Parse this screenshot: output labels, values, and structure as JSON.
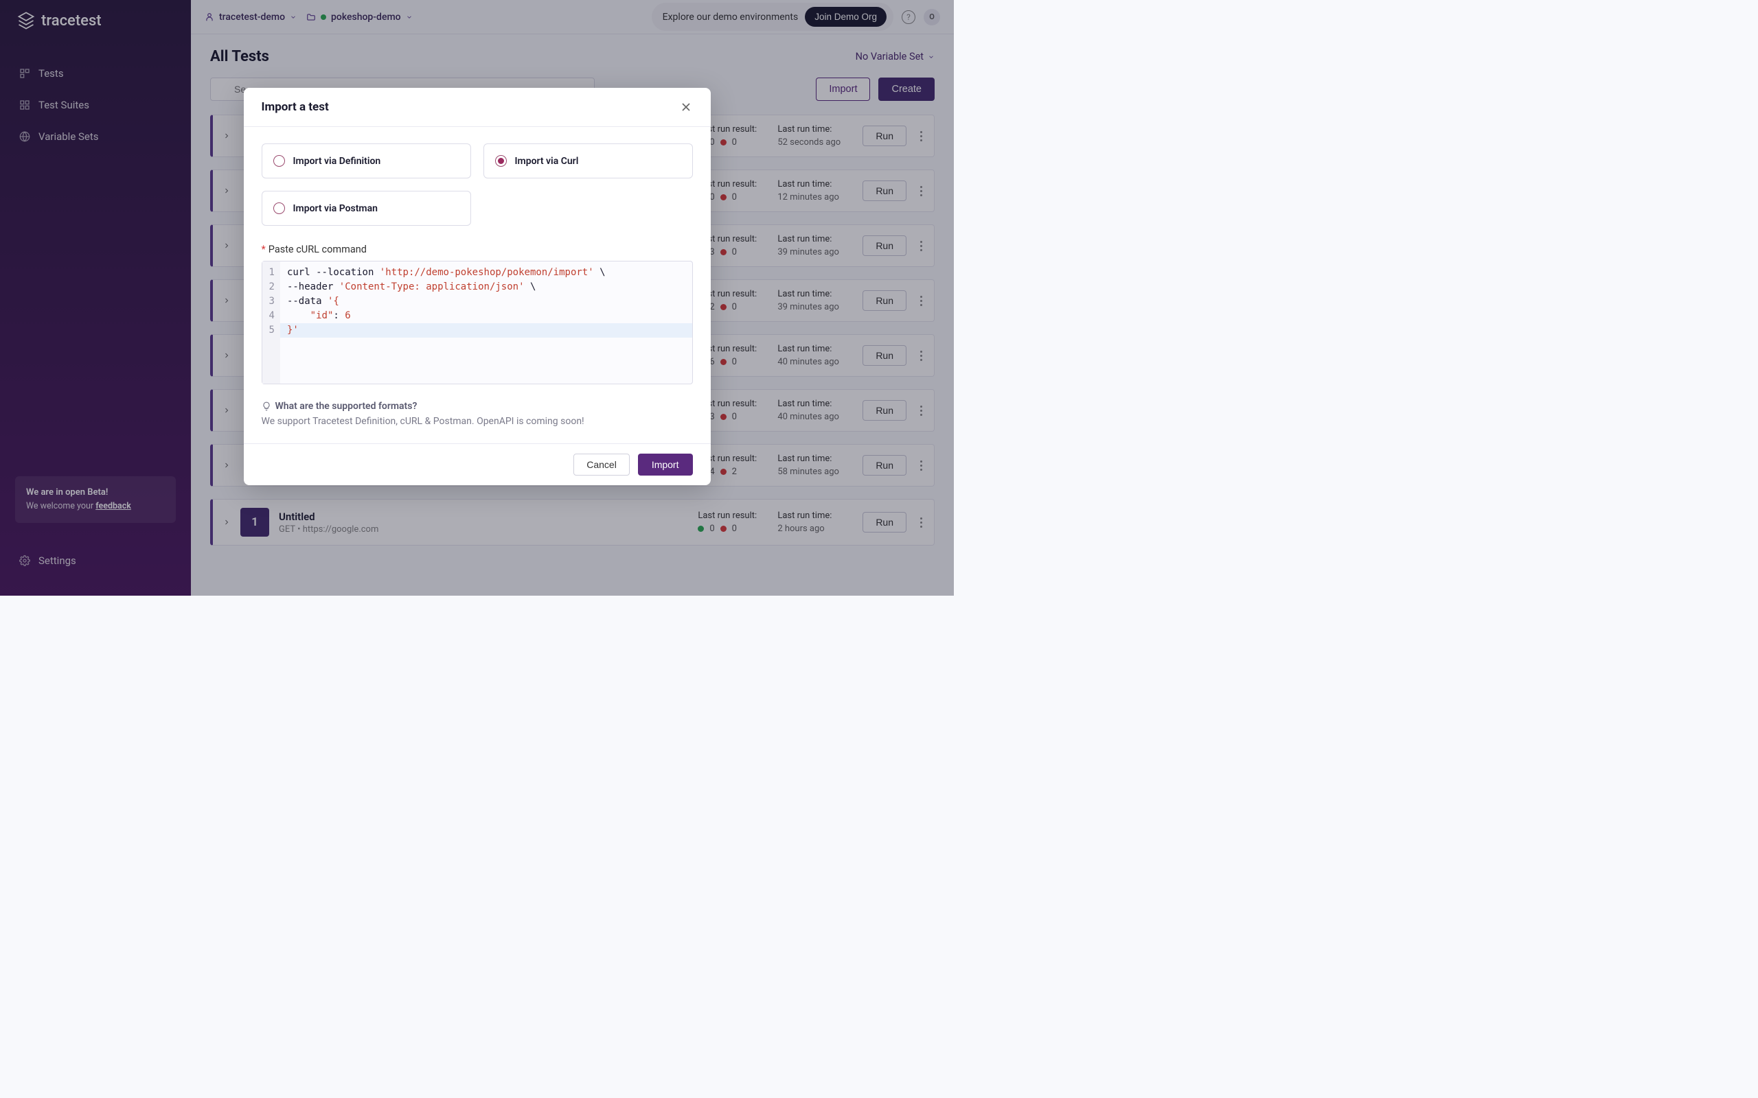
{
  "brand": "tracetest",
  "sidebar": {
    "items": [
      {
        "label": "Tests"
      },
      {
        "label": "Test Suites"
      },
      {
        "label": "Variable Sets"
      }
    ],
    "settings_label": "Settings",
    "beta_title": "We are in open Beta!",
    "beta_sub_prefix": "We welcome your ",
    "beta_feedback": "feedback"
  },
  "topbar": {
    "org": "tracetest-demo",
    "env": "pokeshop-demo",
    "explore": "Explore our demo environments",
    "join": "Join Demo Org",
    "avatar": "O"
  },
  "page": {
    "title": "All Tests",
    "variable_set": "No Variable Set",
    "search_placeholder": "Se",
    "import_btn": "Import",
    "create_btn": "Create"
  },
  "tests": [
    {
      "green": 0,
      "red": 0,
      "time": "52 seconds ago"
    },
    {
      "green": 0,
      "red": 0,
      "time": "12 minutes ago"
    },
    {
      "green": 3,
      "red": 0,
      "time": "39 minutes ago"
    },
    {
      "green": 2,
      "red": 0,
      "time": "39 minutes ago"
    },
    {
      "green": 6,
      "red": 0,
      "time": "40 minutes ago"
    },
    {
      "green": 3,
      "red": 0,
      "time": "40 minutes ago"
    },
    {
      "green": 4,
      "red": 2,
      "time": "58 minutes ago"
    },
    {
      "count": 1,
      "name": "Untitled",
      "method": "GET",
      "url": "https://google.com",
      "green": 0,
      "red": 0,
      "time": "2 hours ago"
    }
  ],
  "row_labels": {
    "result": "Last run result:",
    "time": "Last run time:",
    "run": "Run"
  },
  "modal": {
    "title": "Import a test",
    "options": {
      "definition": "Import via Definition",
      "curl": "Import via Curl",
      "postman": "Import via Postman"
    },
    "field_label": "Paste cURL command",
    "code": {
      "l1_a": "curl --location ",
      "l1_b": "'http://demo-pokeshop/pokemon/import'",
      "l1_c": " \\",
      "l2_a": "--header ",
      "l2_b": "'Content-Type: application/json'",
      "l2_c": " \\",
      "l3_a": "--data ",
      "l3_b": "'{",
      "l4_a": "    ",
      "l4_b": "\"id\"",
      "l4_c": ": ",
      "l4_d": "6",
      "l5_a": "}'"
    },
    "formats_q": "What are the supported formats?",
    "formats_a": "We support Tracetest Definition, cURL & Postman. OpenAPI is coming soon!",
    "cancel": "Cancel",
    "import": "Import"
  }
}
